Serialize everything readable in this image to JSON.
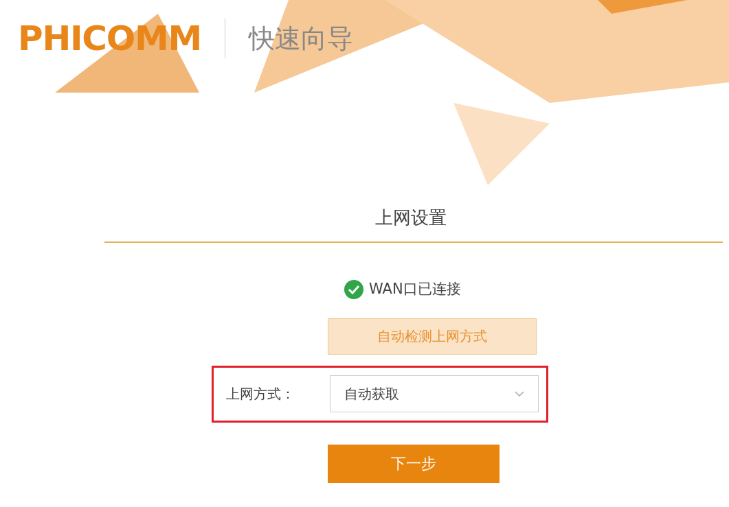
{
  "header": {
    "logo": "PHICOMM",
    "title": "快速向导"
  },
  "section_title": "上网设置",
  "status": {
    "text": "WAN口已连接",
    "connected": true
  },
  "detect_button": "自动检测上网方式",
  "field": {
    "label": "上网方式：",
    "value": "自动获取",
    "highlighted": true
  },
  "next_button": "下一步"
}
